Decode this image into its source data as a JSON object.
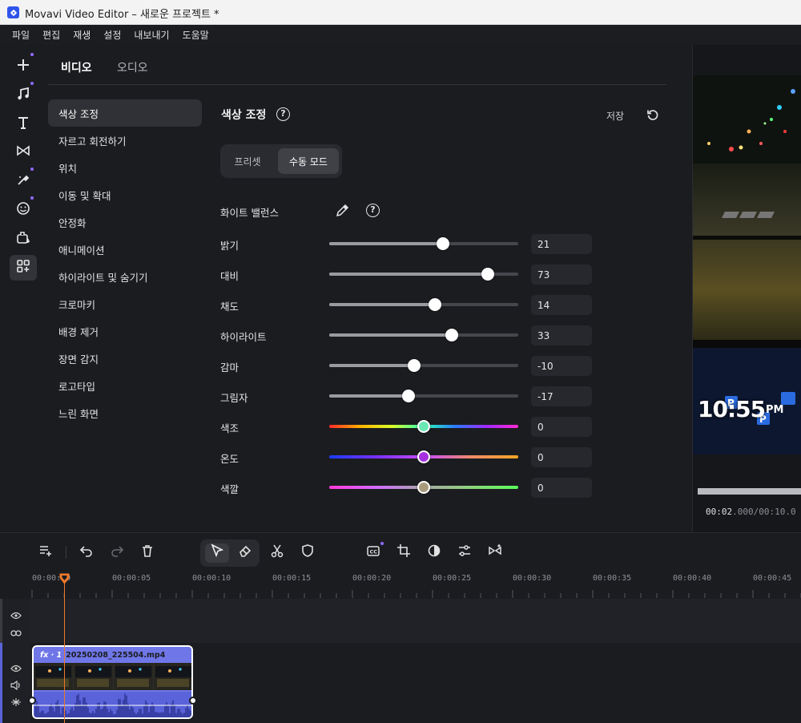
{
  "window": {
    "title": "Movavi Video Editor – 새로운 프로젝트 *"
  },
  "menu": [
    "파일",
    "편집",
    "재생",
    "설정",
    "내보내기",
    "도움말"
  ],
  "rail": {
    "icons": [
      "add-media-icon",
      "music-icon",
      "titles-icon",
      "transitions-icon",
      "filters-icon",
      "stickers-icon",
      "elements-icon",
      "more-tools-icon"
    ]
  },
  "tabs": {
    "video": "비디오",
    "audio": "오디오"
  },
  "nav": {
    "items": [
      "색상 조정",
      "자르고 회전하기",
      "위치",
      "이동 및 확대",
      "안정화",
      "애니메이션",
      "하이라이트 및 숨기기",
      "크로마키",
      "배경 제거",
      "장면 감지",
      "로고타입",
      "느린 화면"
    ]
  },
  "section": {
    "title": "색상 조정",
    "save_label": "저장"
  },
  "mode": {
    "preset": "프리셋",
    "manual": "수동 모드"
  },
  "white_balance": {
    "label": "화이트 밸런스"
  },
  "sliders": [
    {
      "label": "밝기",
      "value": "21",
      "pos": 0.6
    },
    {
      "label": "대비",
      "value": "73",
      "pos": 0.84
    },
    {
      "label": "채도",
      "value": "14",
      "pos": 0.56
    },
    {
      "label": "하이라이트",
      "value": "33",
      "pos": 0.65
    },
    {
      "label": "감마",
      "value": "-10",
      "pos": 0.45
    },
    {
      "label": "그림자",
      "value": "-17",
      "pos": 0.42
    },
    {
      "label": "색조",
      "value": "0",
      "pos": 0.5
    },
    {
      "label": "온도",
      "value": "0",
      "pos": 0.5
    },
    {
      "label": "색깔",
      "value": "0",
      "pos": 0.5
    }
  ],
  "preview": {
    "overlay_time": "10:55",
    "overlay_pm": "PM",
    "timecode_bright": "00:02",
    "timecode_dim": ".000/00:10.0"
  },
  "timeline": {
    "ticks": [
      "00:00:00",
      "00:00:05",
      "00:00:10",
      "00:00:15",
      "00:00:20",
      "00:00:25",
      "00:00:30",
      "00:00:35",
      "00:00:40",
      "00:00:45"
    ],
    "clip": {
      "fx": "fx · 1",
      "filename": "20250208_225504.mp4"
    }
  },
  "colors": {
    "accent": "#8f6bff",
    "playhead": "#f07a2a",
    "clip": "#6f77e8"
  }
}
